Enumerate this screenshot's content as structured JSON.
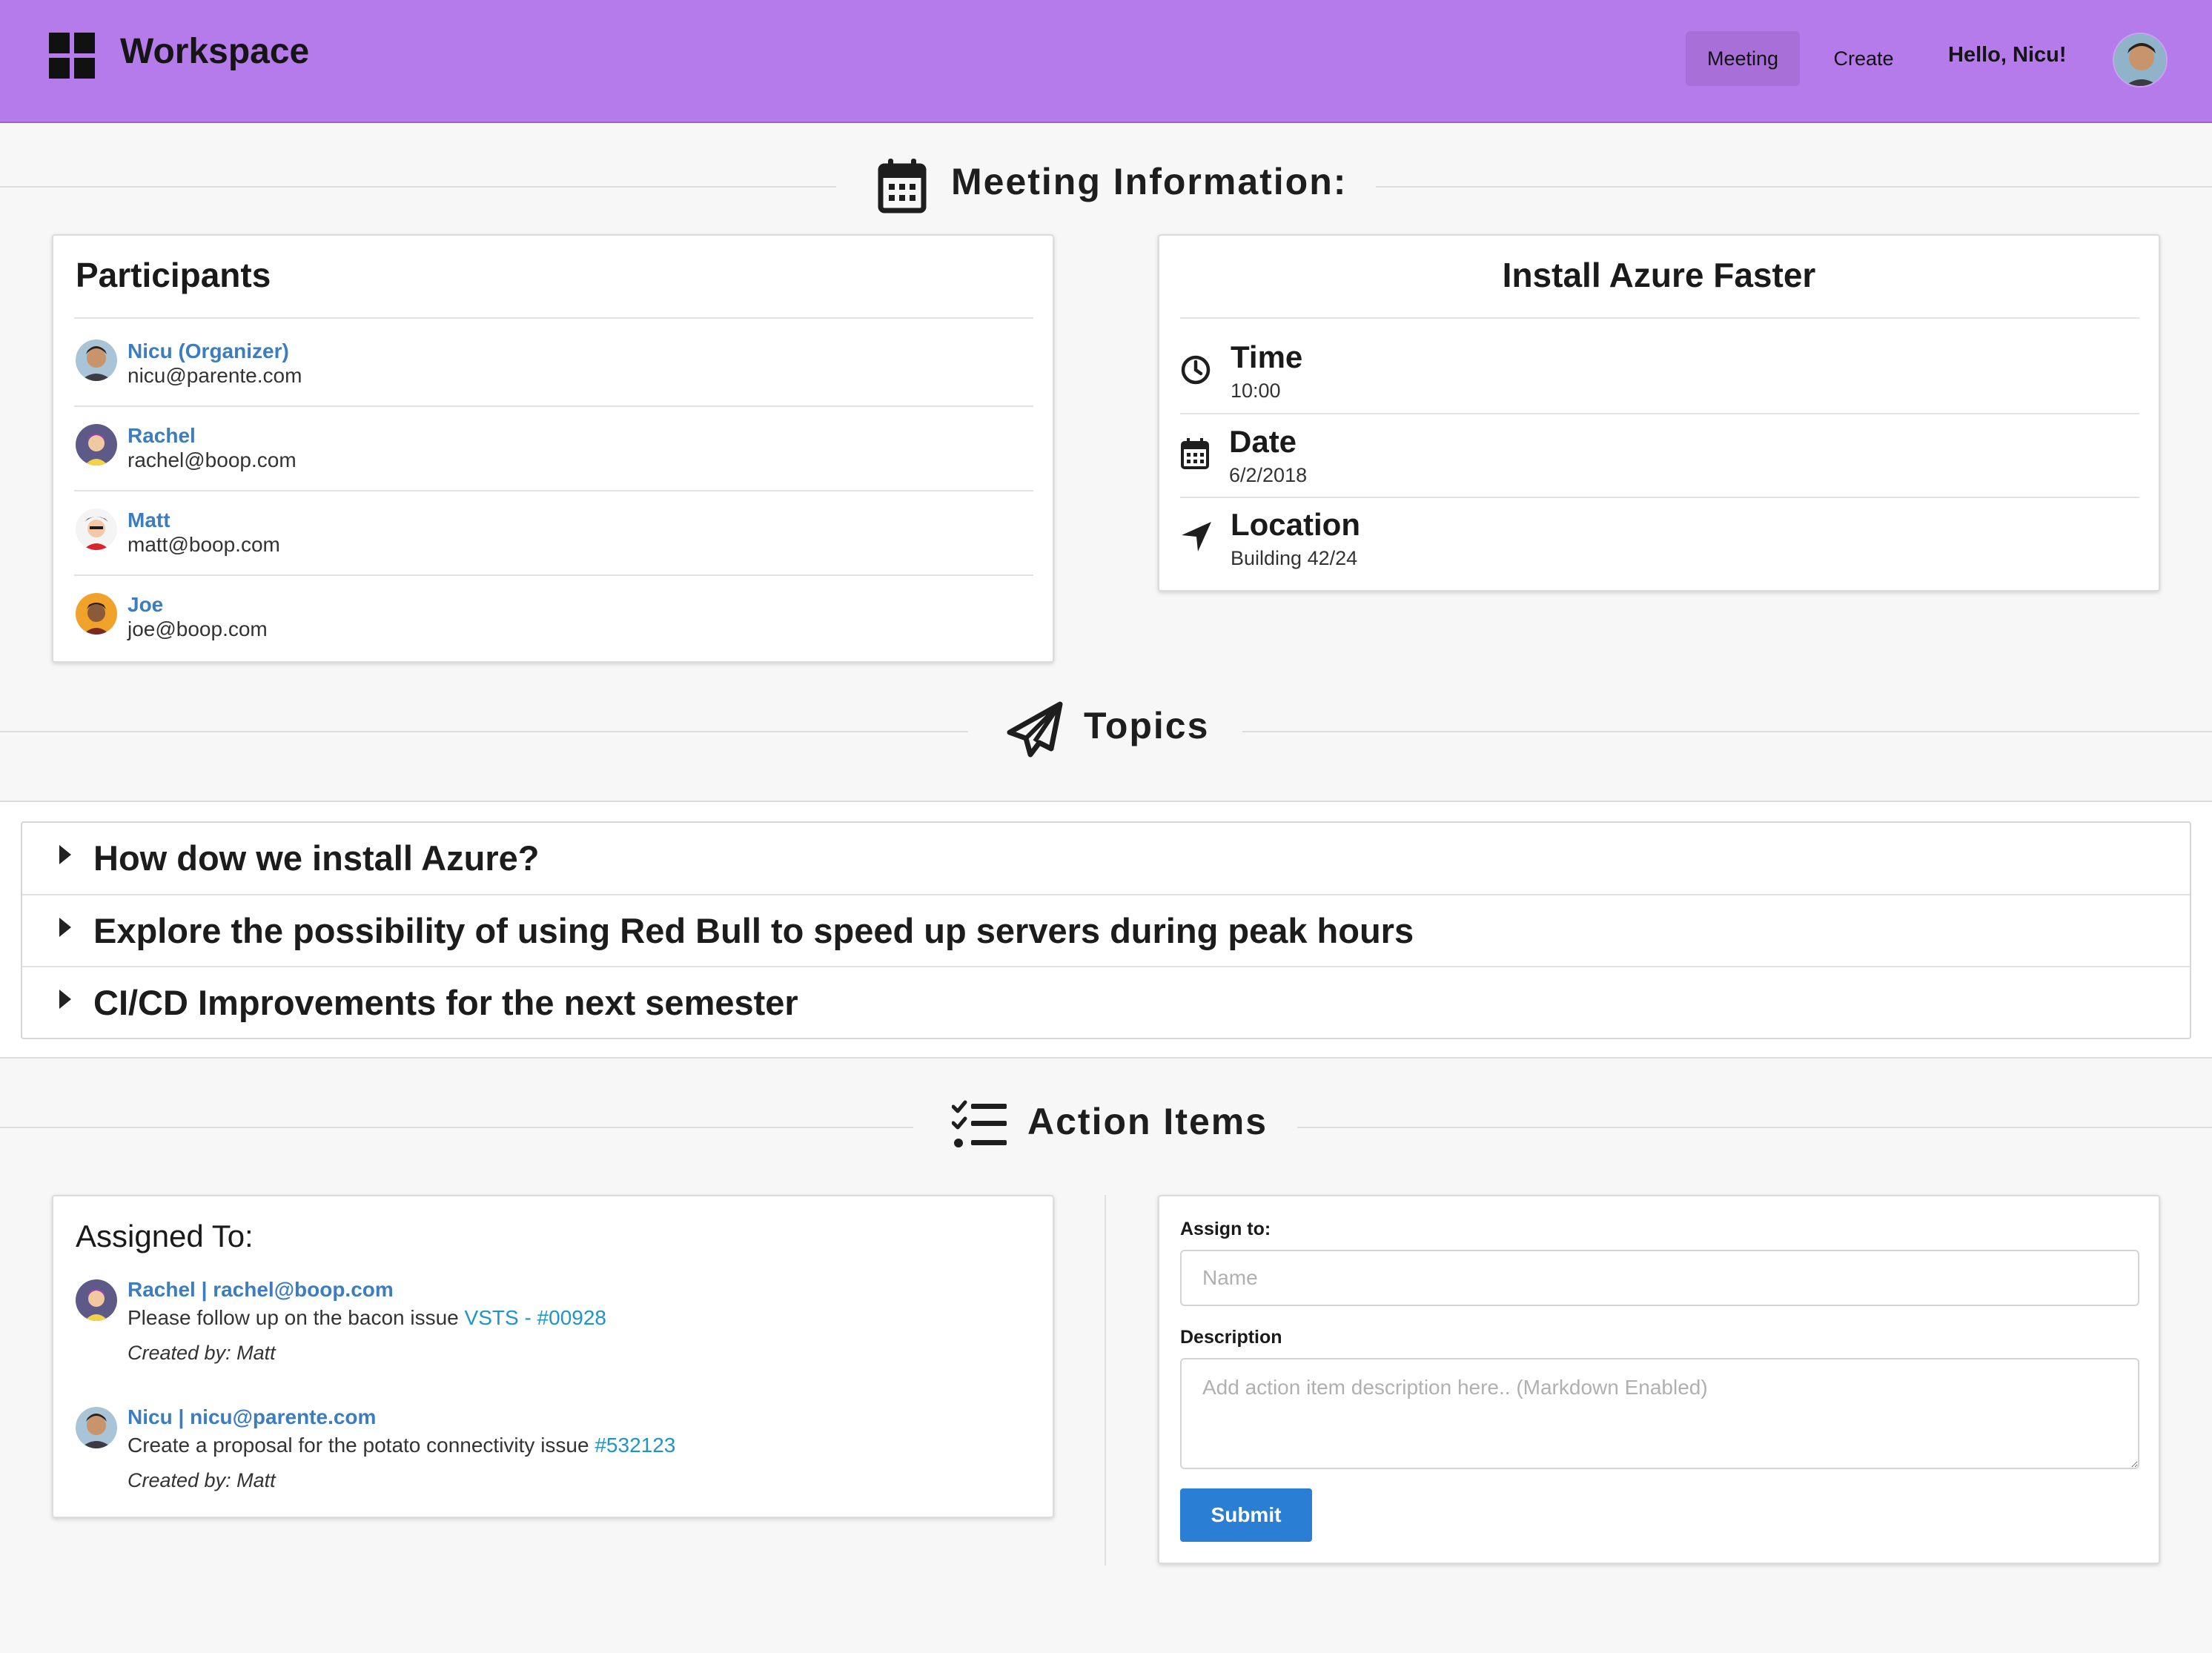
{
  "header": {
    "brand": "Workspace",
    "nav": {
      "meeting": "Meeting",
      "create": "Create"
    },
    "greeting": "Hello, Nicu!"
  },
  "sections": {
    "meeting_info": "Meeting Information:",
    "topics": "Topics",
    "action_items": "Action Items"
  },
  "participants": {
    "title": "Participants",
    "items": [
      {
        "name": "Nicu (Organizer)",
        "email": "nicu@parente.com"
      },
      {
        "name": "Rachel",
        "email": "rachel@boop.com"
      },
      {
        "name": "Matt",
        "email": "matt@boop.com"
      },
      {
        "name": "Joe",
        "email": "joe@boop.com"
      }
    ]
  },
  "meeting": {
    "title": "Install Azure Faster",
    "time_label": "Time",
    "time": "10:00",
    "date_label": "Date",
    "date": "6/2/2018",
    "location_label": "Location",
    "location": "Building 42/24"
  },
  "topics": [
    "How dow we install Azure?",
    "Explore the possibility of using Red Bull to speed up servers during peak hours",
    "CI/CD Improvements for the next semester"
  ],
  "assigned": {
    "title": "Assigned To:",
    "items": [
      {
        "who": "Rachel | rachel@boop.com",
        "text": "Please follow up on the bacon issue ",
        "link": "VSTS - #00928",
        "created": "Created by: Matt"
      },
      {
        "who": "Nicu | nicu@parente.com",
        "text": "Create a proposal for the potato connectivity issue ",
        "link": "#532123",
        "created": "Created by: Matt"
      }
    ]
  },
  "form": {
    "assign_label": "Assign to:",
    "assign_placeholder": "Name",
    "description_label": "Description",
    "description_placeholder": "Add action item description here.. (Markdown Enabled)",
    "submit": "Submit"
  },
  "colors": {
    "header_bg": "#b57bea",
    "link_blue": "#3c7cbf",
    "submit_blue": "#2a7fd4"
  }
}
